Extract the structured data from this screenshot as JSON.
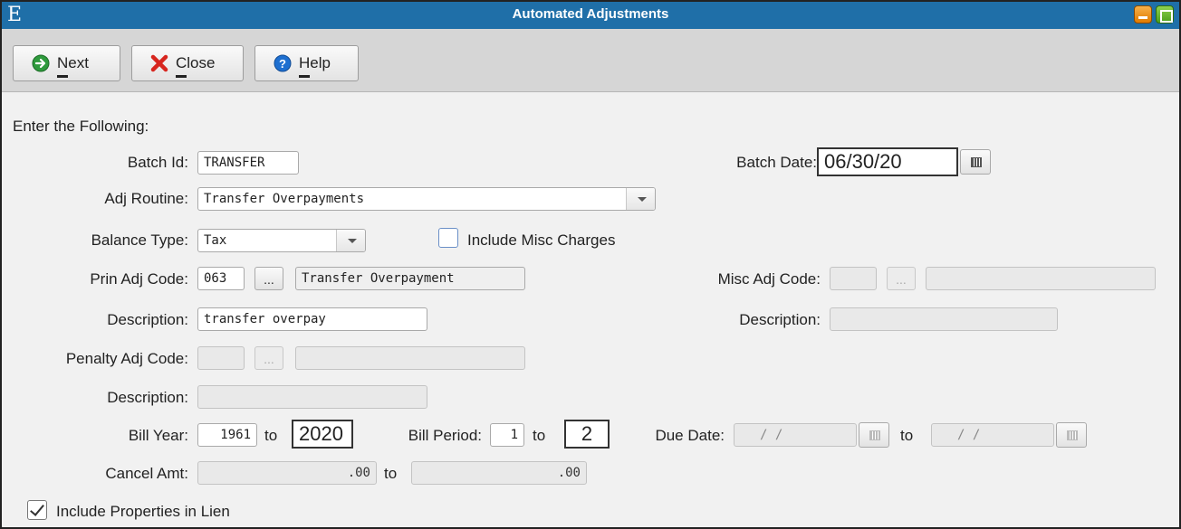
{
  "window": {
    "logo": "E",
    "title": "Automated Adjustments"
  },
  "toolbar": {
    "next_label": "Next",
    "close_label": "Close",
    "help_label": "Help"
  },
  "form": {
    "heading": "Enter the Following:",
    "batch_id": {
      "label": "Batch Id:",
      "value": "TRANSFER"
    },
    "batch_date": {
      "label": "Batch Date:",
      "value": "06/30/20"
    },
    "adj_routine": {
      "label": "Adj Routine:",
      "value": "Transfer Overpayments"
    },
    "balance_type": {
      "label": "Balance Type:",
      "value": "Tax"
    },
    "include_misc": {
      "label": "Include Misc Charges",
      "checked": false
    },
    "prin_adj_code": {
      "label": "Prin Adj Code:",
      "code": "063",
      "button": "...",
      "desc": "Transfer Overpayment"
    },
    "misc_adj_code": {
      "label": "Misc Adj Code:",
      "code": "",
      "button": "...",
      "desc": ""
    },
    "description1": {
      "label": "Description:",
      "value": "transfer overpay"
    },
    "misc_description": {
      "label": "Description:",
      "value": ""
    },
    "penalty_adj_code": {
      "label": "Penalty Adj Code:",
      "code": "",
      "button": "...",
      "desc": ""
    },
    "description2": {
      "label": "Description:",
      "value": ""
    },
    "bill_year": {
      "label": "Bill Year:",
      "from": "1961",
      "to_label": "to",
      "to": "2020"
    },
    "bill_period": {
      "label": "Bill Period:",
      "from": "1",
      "to_label": "to",
      "to": "2"
    },
    "due_date": {
      "label": "Due Date:",
      "from": "/   /",
      "to_label": "to",
      "to": "/   /"
    },
    "cancel_amt": {
      "label": "Cancel Amt:",
      "from": ".00",
      "to_label": "to",
      "to": ".00"
    },
    "include_lien": {
      "label": "Include Properties in Lien",
      "checked": true
    }
  },
  "colors": {
    "titlebar": "#1f6fa8",
    "toolbar": "#d6d6d6",
    "panel": "#f1f1f1"
  }
}
